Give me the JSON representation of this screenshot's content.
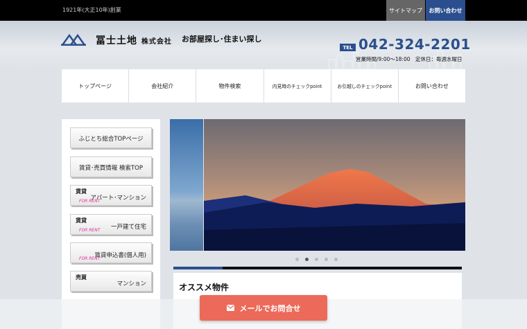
{
  "topbar": {
    "established": "1921年(大正10年)創業",
    "sitemap": "サイトマップ",
    "contact": "お問い合わせ"
  },
  "header": {
    "company_name": "冨士土地",
    "company_suffix": "株式会社",
    "tagline": "お部屋探し･住まい探し",
    "tel_label": "TEL",
    "tel_number": "042-324-2201",
    "hours": "営業時間/9:00～18:00　定休日：毎週水曜日"
  },
  "nav": {
    "items": [
      "トップページ",
      "会社紹介",
      "物件検索",
      "内見時のチェックpoint",
      "お引越しのチェックpoint",
      "お問い合わせ"
    ]
  },
  "sidebar": {
    "top_page": "ふじとち総合TOPページ",
    "search_top": "賃貸･売買情報 検索TOP",
    "apartment": {
      "tag": "賃貸",
      "label": "アパート･マンション",
      "sub": "FOR RENT"
    },
    "house": {
      "tag": "賃貸",
      "label": "一戸建て住宅",
      "sub": "FOR RENT"
    },
    "application": {
      "label": "賃貸申込書(個人用)",
      "sub": "FOR RENT"
    },
    "sale": {
      "tag": "売買",
      "label": "マンション"
    }
  },
  "slider": {
    "image": "mount-fuji-sunset",
    "total_slides": 5,
    "active_slide": 2,
    "progress": 0.17
  },
  "content": {
    "section_title": "オススメ物件"
  },
  "mail_button": {
    "label": "メールでお問合せ",
    "icon": "mail-icon"
  },
  "colors": {
    "brand": "#2b4f8e",
    "accent": "#ec6a5a",
    "rent_pink": "#e0309a"
  }
}
